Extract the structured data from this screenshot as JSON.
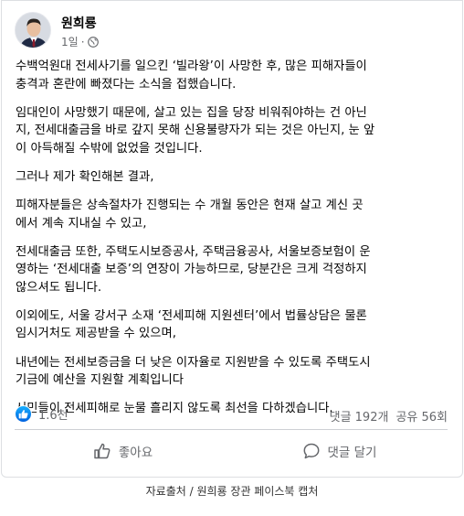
{
  "post": {
    "author": "원희룡",
    "time": "1일",
    "dot": "·",
    "privacy_icon": "globe-icon",
    "paragraphs": [
      [
        "수백억원대 전세사기를 일으킨 ‘빌라왕’이 사망한 후, 많은 피해자들이",
        "충격과 혼란에 빠졌다는 소식을 접했습니다."
      ],
      [
        "임대인이 사망했기 때문에, 살고 있는 집을 당장 비워줘야하는 건 아닌",
        "지, 전세대출금을 바로 갚지 못해 신용불량자가 되는 것은 아닌지, 눈 앞",
        "이 아득해질 수밖에 없었을 것입니다."
      ],
      [
        "그러나 제가 확인해본 결과,"
      ],
      [
        "피해자분들은 상속절차가 진행되는 수 개월 동안은 현재 살고 계신 곳",
        "에서 계속 지내실  수 있고,"
      ],
      [
        "전세대출금 또한, 주택도시보증공사, 주택금융공사, 서울보증보험이 운",
        "영하는 ‘전세대출 보증’의 연장이 가능하므로, 당분간은 크게 걱정하지",
        "않으셔도 됩니다."
      ],
      [
        "이외에도, 서울 강서구 소재 ‘전세피해 지원센터’에서 법률상담은 물론",
        "임시거처도 제공받을 수 있으며,"
      ],
      [
        "내년에는 전세보증금을 더 낮은 이자율로 지원받을 수 있도록 주택도시",
        "기금에 예산을 지원할 계획입니다"
      ],
      [
        "서민들이 전세피해로 눈물 흘리지 않도록 최선을 다하겠습니다."
      ]
    ]
  },
  "stats": {
    "reactions": "1.6천",
    "comments": "댓글 192개",
    "shares": "공유 56회"
  },
  "actions": {
    "like": "좋아요",
    "comment": "댓글 달기"
  },
  "caption": "자료출처 / 원희룡 장관 페이스북 캡처",
  "colors": {
    "like_blue": "#1877f2",
    "secondary_text": "#65676b",
    "divider": "#ced0d4"
  }
}
